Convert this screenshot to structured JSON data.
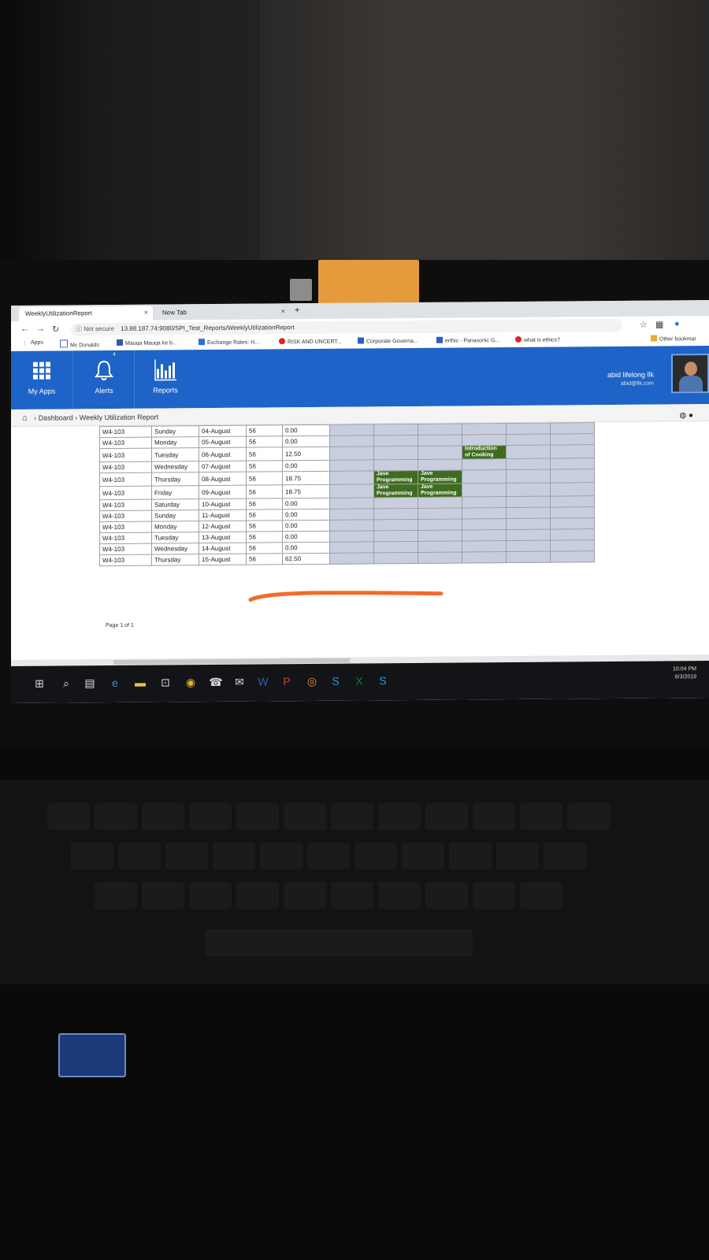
{
  "browser": {
    "tabs": [
      {
        "title": "WeeklyUtilizationReport",
        "active": true
      },
      {
        "title": "New Tab",
        "active": false
      }
    ],
    "new_tab_symbol": "+",
    "security_label": "Not secure",
    "url": "13.88.187.74:9080/SPI_Test_Reports/WeeklyUtilizationReport",
    "bookmarks": [
      {
        "label": "Apps",
        "icon": "apps-grid-icon"
      },
      {
        "label": "Mc Donalds",
        "icon": "page-icon"
      },
      {
        "label": "Mauqa Mauqa ke b...",
        "icon": "page-icon"
      },
      {
        "label": "Exchange Rates: H...",
        "icon": "page-icon"
      },
      {
        "label": "RISK AND UNCERT...",
        "icon": "youtube-icon"
      },
      {
        "label": "Corporate Governa...",
        "icon": "p-icon"
      },
      {
        "label": "erthic - Panasonic G...",
        "icon": "p-icon"
      },
      {
        "label": "what is ethics?",
        "icon": "youtube-icon"
      }
    ],
    "other_bookmarks": "Other bookmar"
  },
  "app": {
    "nav": [
      {
        "label": "My Apps",
        "icon": "grid-icon"
      },
      {
        "label": "Alerts",
        "icon": "bell-icon",
        "badge": "4"
      },
      {
        "label": "Reports",
        "icon": "bar-chart-icon"
      }
    ],
    "user_name": "abid lifelong llk",
    "user_email": "abid@llk.com",
    "breadcrumb": [
      "Dashboard",
      "Weekly Utilization Report"
    ],
    "accent_color": "#1e63c7"
  },
  "report": {
    "rows": [
      {
        "room": "W4-103",
        "day": "Sunday",
        "date": "04-August",
        "capacity": "56",
        "hours": "0.00"
      },
      {
        "room": "W4-103",
        "day": "Monday",
        "date": "05-August",
        "capacity": "56",
        "hours": "0.00"
      },
      {
        "room": "W4-103",
        "day": "Tuesday",
        "date": "06-August",
        "capacity": "56",
        "hours": "12.50"
      },
      {
        "room": "W4-103",
        "day": "Wednesday",
        "date": "07-August",
        "capacity": "56",
        "hours": "0.00"
      },
      {
        "room": "W4-103",
        "day": "Thursday",
        "date": "08-August",
        "capacity": "56",
        "hours": "18.75"
      },
      {
        "room": "W4-103",
        "day": "Friday",
        "date": "09-August",
        "capacity": "56",
        "hours": "18.75"
      },
      {
        "room": "W4-103",
        "day": "Saturday",
        "date": "10-August",
        "capacity": "56",
        "hours": "0.00"
      },
      {
        "room": "W4-103",
        "day": "Sunday",
        "date": "11-August",
        "capacity": "56",
        "hours": "0.00"
      },
      {
        "room": "W4-103",
        "day": "Monday",
        "date": "12-August",
        "capacity": "56",
        "hours": "0.00"
      },
      {
        "room": "W4-103",
        "day": "Tuesday",
        "date": "13-August",
        "capacity": "56",
        "hours": "0.00"
      },
      {
        "room": "W4-103",
        "day": "Wednesday",
        "date": "14-August",
        "capacity": "56",
        "hours": "0.00"
      },
      {
        "room": "W4-103",
        "day": "Thursday",
        "date": "15-August",
        "capacity": "56",
        "hours": "62.50"
      }
    ],
    "sessions": {
      "cooking": "Introduction of Cooking",
      "java": "Jave Programming"
    },
    "session_color": "#3f6c1e",
    "page_info": "Page 1 of 1"
  },
  "taskbar": {
    "time": "10:04 PM",
    "date": "8/3/2019",
    "icons": [
      "windows-icon",
      "search-icon",
      "task-view-icon",
      "edge-icon",
      "file-explorer-icon",
      "store-icon",
      "chrome-icon",
      "phone-icon",
      "mail-icon",
      "word-icon",
      "powerpoint-icon",
      "origin-icon",
      "skype-icon",
      "excel-icon",
      "skype-business-icon"
    ]
  }
}
